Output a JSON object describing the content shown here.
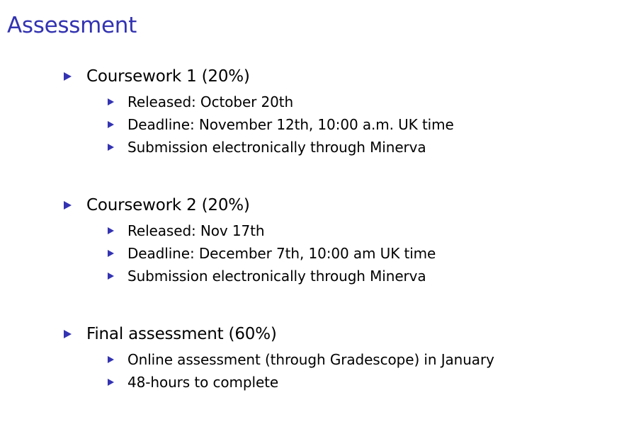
{
  "title": "Assessment",
  "accent_color": "#3333b2",
  "bullet_icon": "triangle-right",
  "items": [
    {
      "label": "Coursework 1 (20%)",
      "sub": [
        "Released: October 20th",
        "Deadline: November 12th, 10:00 a.m. UK time",
        "Submission electronically through Minerva"
      ]
    },
    {
      "label": "Coursework 2 (20%)",
      "sub": [
        "Released: Nov 17th",
        "Deadline: December 7th, 10:00 am UK time",
        "Submission electronically through Minerva"
      ]
    },
    {
      "label": "Final assessment (60%)",
      "sub": [
        "Online assessment (through Gradescope) in January",
        "48-hours to complete"
      ]
    }
  ]
}
